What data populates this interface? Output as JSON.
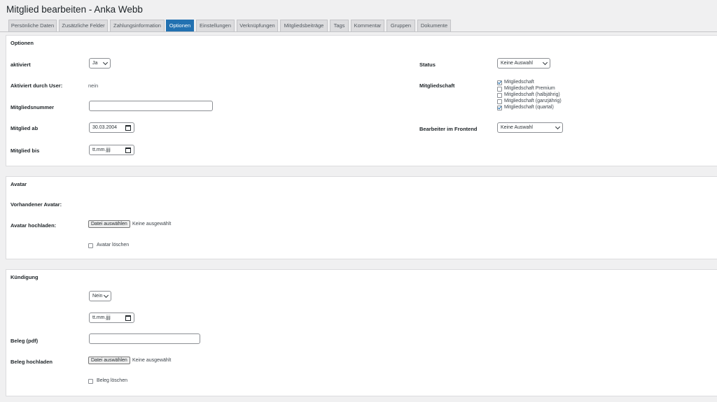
{
  "header": {
    "title": "Mitglied bearbeiten - Anka Webb"
  },
  "tabs": [
    {
      "label": "Persönliche Daten",
      "active": false
    },
    {
      "label": "Zusätzliche Felder",
      "active": false
    },
    {
      "label": "Zahlungsinformation",
      "active": false
    },
    {
      "label": "Optionen",
      "active": true
    },
    {
      "label": "Einstellungen",
      "active": false
    },
    {
      "label": "Verknüpfungen",
      "active": false
    },
    {
      "label": "Mitgliedsbeiträge",
      "active": false
    },
    {
      "label": "Tags",
      "active": false
    },
    {
      "label": "Kommentar",
      "active": false
    },
    {
      "label": "Gruppen",
      "active": false
    },
    {
      "label": "Dokumente",
      "active": false
    }
  ],
  "options": {
    "title": "Optionen",
    "activated": {
      "label": "aktiviert",
      "value": "Ja"
    },
    "activated_by_user": {
      "label": "Aktiviert durch User:",
      "value": "nein"
    },
    "member_number": {
      "label": "Mitgliedsnummer",
      "value": ""
    },
    "member_since": {
      "label": "Mitglied ab",
      "value": "30.03.2004"
    },
    "member_until": {
      "label": "Mitglied bis",
      "value": "tt.mm.jjjj"
    },
    "status": {
      "label": "Status",
      "value": "Keine Auswahl"
    },
    "membership": {
      "label": "Mitgliedschaft",
      "options": [
        {
          "label": "Mitgliedschaft",
          "checked": true
        },
        {
          "label": "Mitgliedschaft Premium",
          "checked": false
        },
        {
          "label": "Mitgliedschaft (halbjährig)",
          "checked": false
        },
        {
          "label": "Mitgliedschaft (ganzjährig)",
          "checked": false
        },
        {
          "label": "Mitgliedschaft (quartal)",
          "checked": true
        }
      ]
    },
    "frontend_editor": {
      "label": "Bearbeiter im Frontend",
      "value": "Keine Auswahl"
    }
  },
  "avatar": {
    "title": "Avatar",
    "existing_label": "Vorhandener Avatar:",
    "upload_label": "Avatar hochladen:",
    "file_button": "Datei auswählen",
    "file_status": "Keine ausgewählt",
    "delete_label": "Avatar löschen",
    "delete_checked": false
  },
  "cancellation": {
    "title": "Kündigung",
    "cancel_value": "Nein",
    "date_value": "tt.mm.jjjj",
    "receipt_label": "Beleg (pdf)",
    "receipt_value": "",
    "upload_label": "Beleg hochladen",
    "file_button": "Datei auswählen",
    "file_status": "Keine ausgewählt",
    "delete_label": "Beleg löschen",
    "delete_checked": false
  },
  "colors": {
    "accent": "#2271b1",
    "background": "#f0f0f1",
    "panel": "#ffffff"
  }
}
